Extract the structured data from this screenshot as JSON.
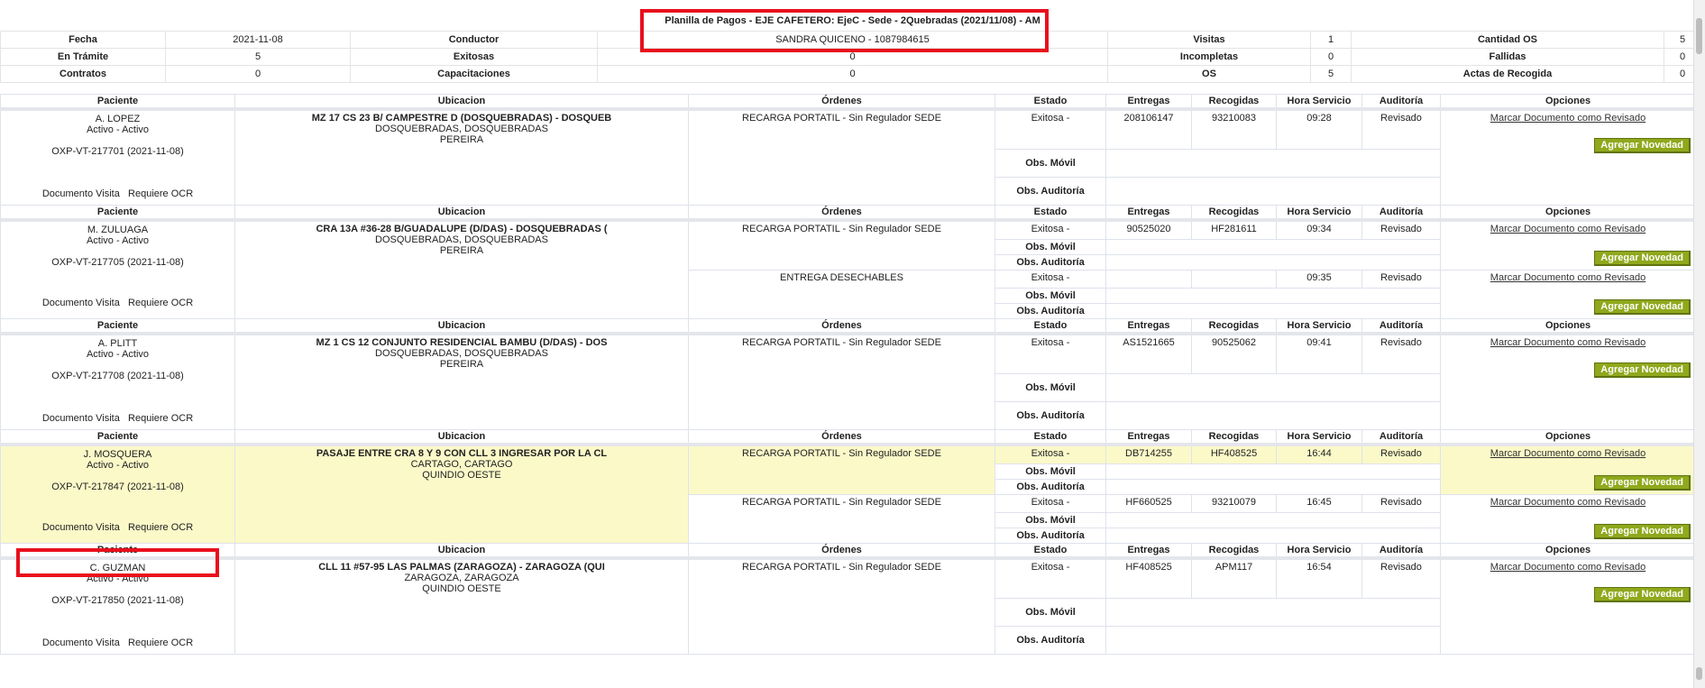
{
  "summary": {
    "title": "Planilla de Pagos - EJE CAFETERO: EjeC - Sede - 2Quebradas (2021/11/08) - AM",
    "rows": [
      [
        "Fecha",
        "2021-11-08",
        "Conductor",
        "SANDRA QUICENO - 1087984615",
        "Visitas",
        "1",
        "Cantidad OS",
        "5"
      ],
      [
        "En Trámite",
        "5",
        "Exitosas",
        "0",
        "Incompletas",
        "0",
        "Fallidas",
        "0"
      ],
      [
        "Contratos",
        "0",
        "Capacitaciones",
        "0",
        "OS",
        "5",
        "Actas de Recogida",
        "0"
      ]
    ]
  },
  "headers": [
    "Paciente",
    "Ubicacion",
    "Órdenes",
    "Estado",
    "Entregas",
    "Recogidas",
    "Hora Servicio",
    "Auditoría",
    "Opciones"
  ],
  "labels": {
    "obs_movil": "Obs. Móvil",
    "obs_auditoria": "Obs. Auditoría",
    "doc_visita": "Documento Visita",
    "requiere_ocr": "Requiere OCR",
    "marcar": "Marcar Documento como Revisado",
    "agregar": "Agregar Novedad"
  },
  "visits": [
    {
      "name": "A. LOPEZ",
      "status": "Activo - Activo",
      "oxp": "OXP-VT-217701 (2021-11-08)",
      "address": "MZ 17 CS 23 B/ CAMPESTRE D (DOSQUEBRADAS) - DOSQUEB",
      "city": "DOSQUEBRADAS, DOSQUEBRADAS",
      "region": "PEREIRA",
      "orders": [
        {
          "orden": "RECARGA PORTATIL - Sin Regulador SEDE",
          "estado": "Exitosa -",
          "entregas": "208106147",
          "recogidas": "93210083",
          "hora": "09:28",
          "auditoria": "Revisado"
        }
      ]
    },
    {
      "name": "M. ZULUAGA",
      "status": "Activo - Activo",
      "oxp": "OXP-VT-217705 (2021-11-08)",
      "address": "CRA 13A #36-28 B/GUADALUPE (D/DAS) - DOSQUEBRADAS (",
      "city": "DOSQUEBRADAS, DOSQUEBRADAS",
      "region": "PEREIRA",
      "orders": [
        {
          "orden": "RECARGA PORTATIL - Sin Regulador SEDE",
          "estado": "Exitosa -",
          "entregas": "90525020",
          "recogidas": "HF281611",
          "hora": "09:34",
          "auditoria": "Revisado"
        },
        {
          "orden": "ENTREGA DESECHABLES",
          "estado": "Exitosa -",
          "entregas": "",
          "recogidas": "",
          "hora": "09:35",
          "auditoria": "Revisado"
        }
      ]
    },
    {
      "name": "A. PLITT",
      "status": "Activo - Activo",
      "oxp": "OXP-VT-217708 (2021-11-08)",
      "address": "MZ 1 CS 12 CONJUNTO RESIDENCIAL BAMBU (D/DAS) - DOS",
      "city": "DOSQUEBRADAS, DOSQUEBRADAS",
      "region": "PEREIRA",
      "orders": [
        {
          "orden": "RECARGA PORTATIL - Sin Regulador SEDE",
          "estado": "Exitosa -",
          "entregas": "AS1521665",
          "recogidas": "90525062",
          "hora": "09:41",
          "auditoria": "Revisado"
        }
      ]
    },
    {
      "name": "J. MOSQUERA",
      "status": "Activo - Activo",
      "oxp": "OXP-VT-217847 (2021-11-08)",
      "address": "PASAJE ENTRE CRA 8 Y 9 CON CLL 3 INGRESAR POR LA CL",
      "city": "CARTAGO, CARTAGO",
      "region": "QUINDIO OESTE",
      "highlight": true,
      "orders": [
        {
          "orden": "RECARGA PORTATIL - Sin Regulador SEDE",
          "estado": "Exitosa -",
          "entregas": "DB714255",
          "recogidas": "HF408525",
          "hora": "16:44",
          "auditoria": "Revisado"
        },
        {
          "orden": "RECARGA PORTATIL - Sin Regulador SEDE",
          "estado": "Exitosa -",
          "entregas": "HF660525",
          "recogidas": "93210079",
          "hora": "16:45",
          "auditoria": "Revisado"
        }
      ]
    },
    {
      "name": "C. GUZMAN",
      "status": "Activo - Activo",
      "oxp": "OXP-VT-217850 (2021-11-08)",
      "address": "CLL 11 #57-95 LAS PALMAS (ZARAGOZA) - ZARAGOZA (QUI",
      "city": "ZARAGOZA, ZARAGOZA",
      "region": "QUINDIO OESTE",
      "orders": [
        {
          "orden": "RECARGA PORTATIL - Sin Regulador SEDE",
          "estado": "Exitosa -",
          "entregas": "HF408525",
          "recogidas": "APM117",
          "hora": "16:54",
          "auditoria": "Revisado"
        }
      ]
    }
  ]
}
